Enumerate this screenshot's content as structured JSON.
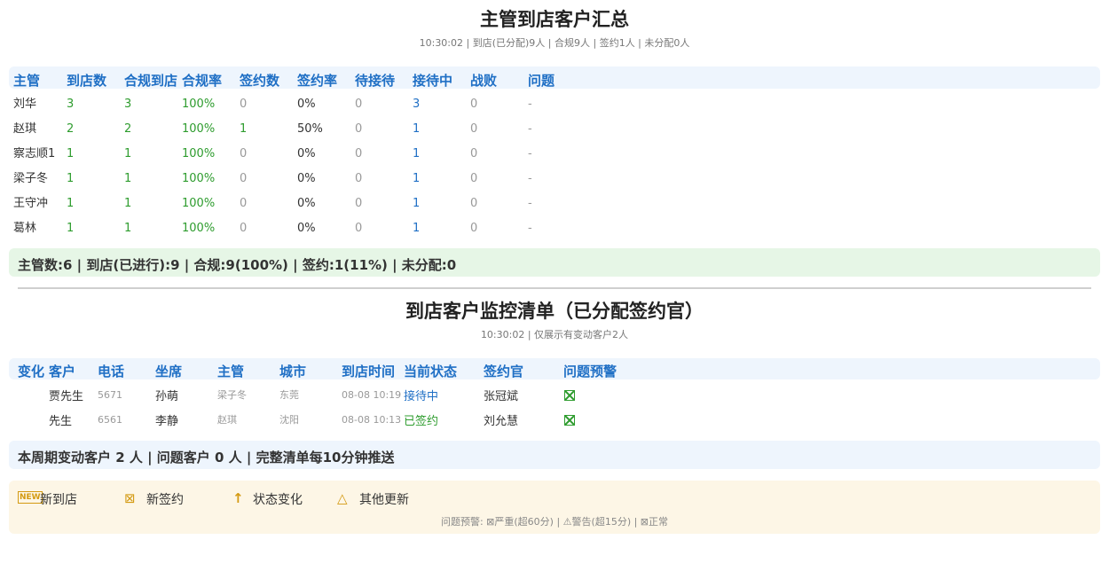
{
  "section1": {
    "title": "主管到店客户汇总",
    "subtitle": "10:30:02 | 到店(已分配)9人 | 合规9人 | 签约1人 | 未分配0人",
    "columns": [
      "主管",
      "到店数",
      "合规到店",
      "合规率",
      "签约数",
      "签约率",
      "待接待",
      "接待中",
      "战败",
      "问题"
    ],
    "rows": [
      [
        "刘华",
        "3",
        "3",
        "100%",
        "0",
        "0%",
        "0",
        "3",
        "0",
        "-"
      ],
      [
        "赵琪",
        "2",
        "2",
        "100%",
        "1",
        "50%",
        "0",
        "1",
        "0",
        "-"
      ],
      [
        "察志顺1",
        "1",
        "1",
        "100%",
        "0",
        "0%",
        "0",
        "1",
        "0",
        "-"
      ],
      [
        "梁子冬",
        "1",
        "1",
        "100%",
        "0",
        "0%",
        "0",
        "1",
        "0",
        "-"
      ],
      [
        "王守冲",
        "1",
        "1",
        "100%",
        "0",
        "0%",
        "0",
        "1",
        "0",
        "-"
      ],
      [
        "葛林",
        "1",
        "1",
        "100%",
        "0",
        "0%",
        "0",
        "1",
        "0",
        "-"
      ]
    ],
    "summary": "主管数:6 | 到店(已进行):9 | 合规:9(100%) | 签约:1(11%) | 未分配:0"
  },
  "section2": {
    "title": "到店客户监控清单（已分配签约官）",
    "subtitle": "10:30:02 | 仅展示有变动客户2人",
    "columns": [
      "变化",
      "客户",
      "电话",
      "坐席",
      "主管",
      "城市",
      "到店时间",
      "当前状态",
      "签约官",
      "问题预警"
    ],
    "rows": [
      {
        "change": "",
        "customer": "贾先生",
        "phone": "5671",
        "agent": "孙萌",
        "manager": "梁子冬",
        "city": "东莞",
        "time": "08-08 10:19",
        "status": "接待中",
        "officer": "张冠斌"
      },
      {
        "change": "",
        "customer": "先生",
        "phone": "6561",
        "agent": "李静",
        "manager": "赵琪",
        "city": "沈阳",
        "time": "08-08 10:13",
        "status": "已签约",
        "officer": "刘允慧"
      }
    ],
    "summary": "本周期变动客户 2 人 | 问题客户 0 人 | 完整清单每10分钟推送"
  },
  "legend": {
    "items": [
      {
        "icon": "new-icon",
        "label": "新到店"
      },
      {
        "icon": "box-x-icon",
        "label": "新签约"
      },
      {
        "icon": "arrow-up-icon",
        "label": "状态变化"
      },
      {
        "icon": "triangle-icon",
        "label": "其他更新"
      }
    ],
    "note": "问题预警: ⊠严重(超60分) | ⚠警告(超15分) | ⊠正常"
  },
  "colors": {
    "accent": "#1f6fc5",
    "green": "#2e9c2e",
    "summary_green_bg": "#e6f6e6",
    "summary_blue_bg": "#eef5fd",
    "legend_bg": "#fdf6e6",
    "legend_icon": "#d49a12"
  }
}
